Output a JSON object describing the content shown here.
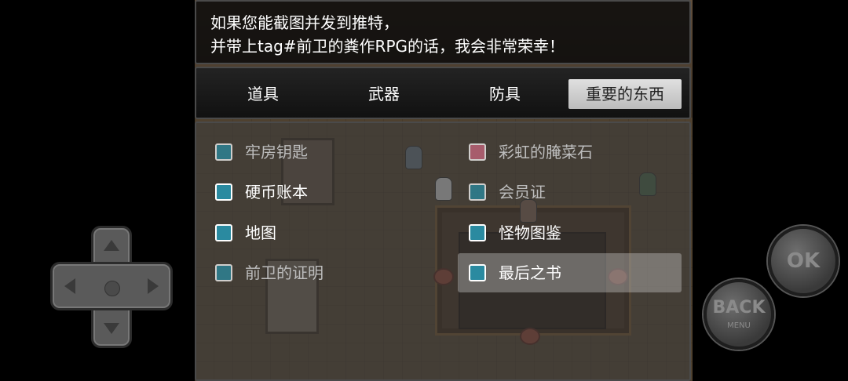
{
  "message": {
    "line1": "如果您能截图并发到推特，",
    "line2": "并带上tag#前卫的粪作RPG的话，我会非常荣幸！"
  },
  "categories": [
    {
      "label": "道具",
      "active": false
    },
    {
      "label": "武器",
      "active": false
    },
    {
      "label": "防具",
      "active": false
    },
    {
      "label": "重要的东西",
      "active": true
    }
  ],
  "items": [
    {
      "label": "牢房钥匙",
      "icon": "key-icon",
      "enabled": false
    },
    {
      "label": "彩虹的腌菜石",
      "icon": "gift-box-icon",
      "enabled": false
    },
    {
      "label": "硬币账本",
      "icon": "ledger-icon",
      "enabled": true
    },
    {
      "label": "会员证",
      "icon": "card-icon",
      "enabled": false
    },
    {
      "label": "地图",
      "icon": "map-icon",
      "enabled": true
    },
    {
      "label": "怪物图鉴",
      "icon": "book-icon",
      "enabled": true
    },
    {
      "label": "前卫的证明",
      "icon": "card-icon",
      "enabled": false
    },
    {
      "label": "最后之书",
      "icon": "book-icon",
      "enabled": true,
      "selected": true
    }
  ],
  "controls": {
    "ok_label": "OK",
    "back_label": "BACK",
    "back_sub": "MENU"
  },
  "colors": {
    "selected_tab": "#cfcfcf",
    "icon_teal": "#2a8aa0",
    "icon_pink": "#c9677f"
  }
}
